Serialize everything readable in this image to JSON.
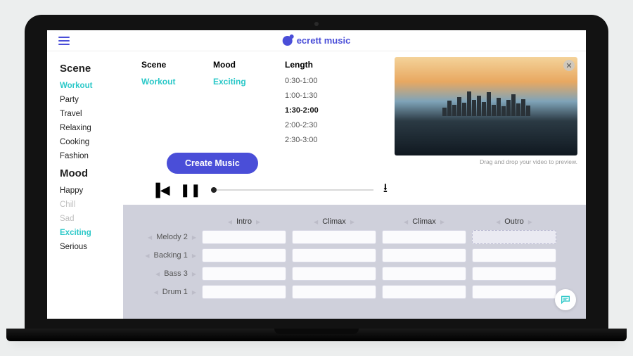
{
  "brand": {
    "name": "ecrett music"
  },
  "sidebar": {
    "scene_heading": "Scene",
    "scenes": [
      "Workout",
      "Party",
      "Travel",
      "Relaxing",
      "Cooking",
      "Fashion"
    ],
    "scene_active": "Workout",
    "mood_heading": "Mood",
    "moods": [
      {
        "label": "Happy",
        "state": "normal"
      },
      {
        "label": "Chill",
        "state": "muted"
      },
      {
        "label": "Sad",
        "state": "muted"
      },
      {
        "label": "Exciting",
        "state": "active"
      },
      {
        "label": "Serious",
        "state": "normal"
      }
    ]
  },
  "selectors": {
    "headings": {
      "scene": "Scene",
      "mood": "Mood",
      "length": "Length"
    },
    "scene_value": "Workout",
    "mood_value": "Exciting",
    "lengths": [
      "0:30-1:00",
      "1:00-1:30",
      "1:30-2:00",
      "2:00-2:30",
      "2:30-3:00"
    ],
    "length_selected": "1:30-2:00"
  },
  "buttons": {
    "create": "Create Music"
  },
  "video_hint": "Drag and drop your video to preview.",
  "grid": {
    "columns": [
      "Intro",
      "Climax",
      "Climax",
      "Outro"
    ],
    "rows": [
      "Melody 2",
      "Backing 1",
      "Bass 3",
      "Drum 1"
    ]
  }
}
